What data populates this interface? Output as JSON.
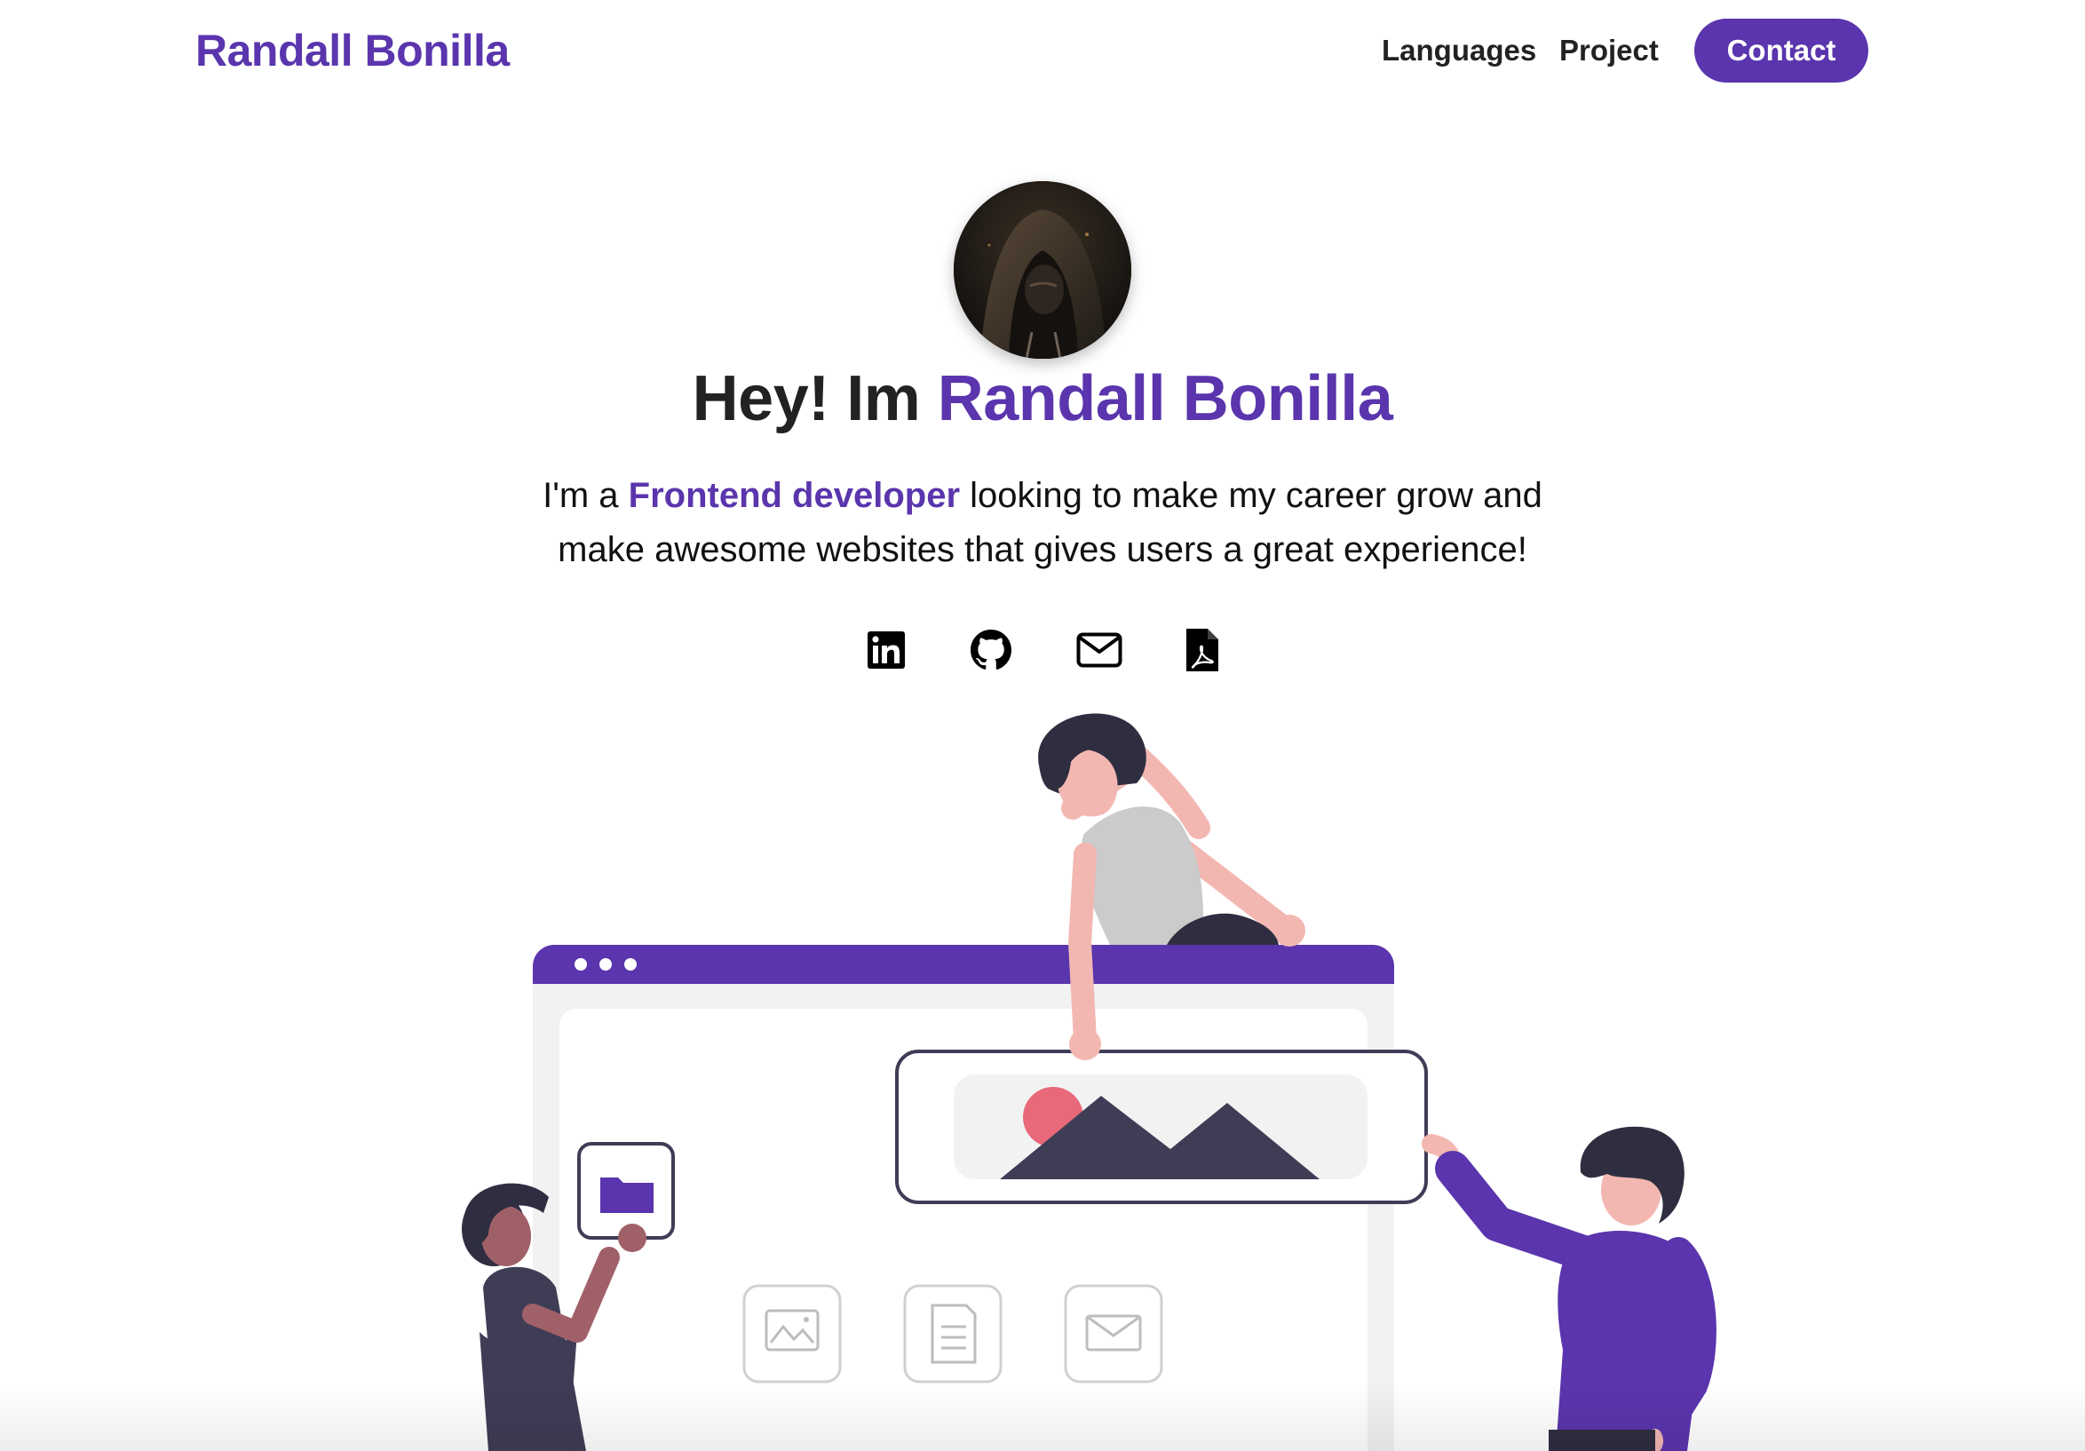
{
  "navbar": {
    "brand": "Randall Bonilla",
    "links": [
      "Languages",
      "Project"
    ],
    "contact_label": "Contact"
  },
  "hero": {
    "title_prefix": "Hey! Im ",
    "title_name": "Randall Bonilla",
    "subtitle_prefix": "I'm a ",
    "subtitle_highlight": "Frontend developer",
    "subtitle_suffix": " looking to make my career grow and make awesome websites that gives users a great experience!"
  },
  "socials": [
    {
      "name": "linkedin",
      "icon": "linkedin-icon"
    },
    {
      "name": "github",
      "icon": "github-icon"
    },
    {
      "name": "email",
      "icon": "email-icon"
    },
    {
      "name": "cv",
      "icon": "pdf-icon"
    }
  ],
  "colors": {
    "accent": "#5a35ad",
    "text": "#222222",
    "background": "#ffffff"
  }
}
